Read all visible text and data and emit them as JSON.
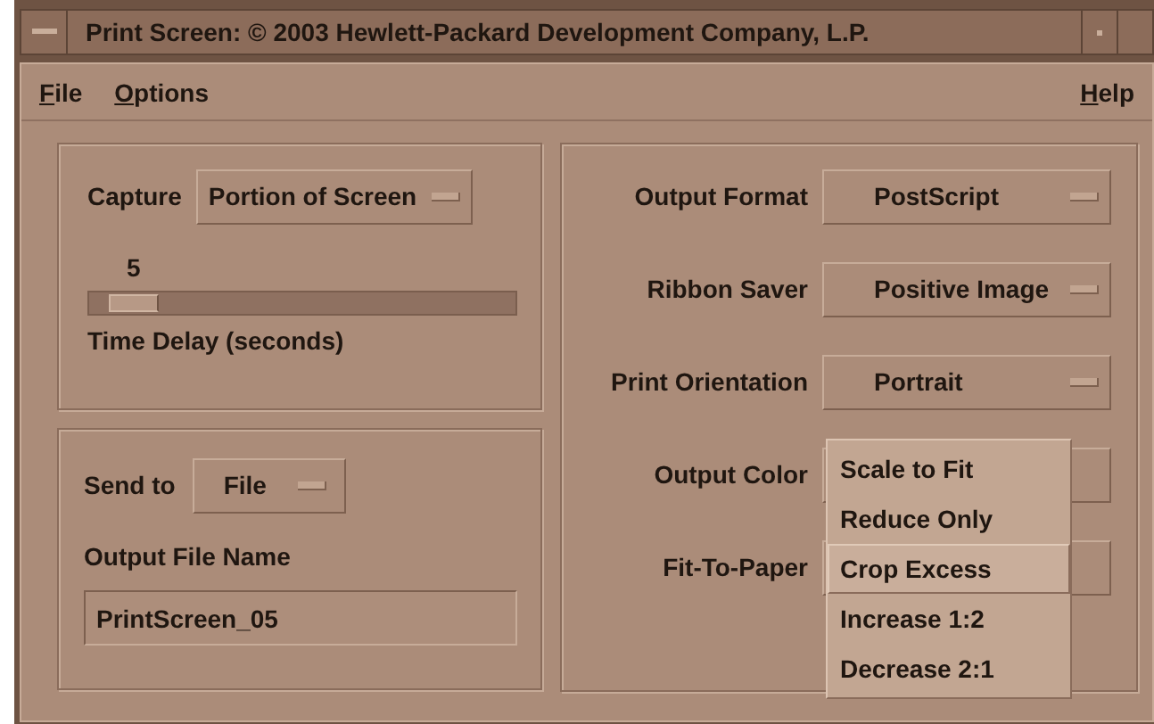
{
  "window": {
    "title": "Print Screen:  © 2003 Hewlett-Packard Development Company, L.P."
  },
  "menu_bar": {
    "left": [
      {
        "label": "File"
      },
      {
        "label": "Options"
      }
    ],
    "right": [
      {
        "label": "Help"
      }
    ]
  },
  "capture": {
    "label": "Capture",
    "value": "Portion of Screen"
  },
  "time_delay": {
    "reading": "5",
    "level": 0.05,
    "label": "Time Delay (seconds)"
  },
  "send_to": {
    "label": "Send to",
    "value": "File"
  },
  "output_file": {
    "label": "Output File Name",
    "value": "PrintScreen_05"
  },
  "options": [
    {
      "label": "Output Format",
      "value": "PostScript"
    },
    {
      "label": "Ribbon Saver",
      "value": "Positive Image"
    },
    {
      "label": "Print Orientation",
      "value": "Portrait"
    },
    {
      "label": "Output Color"
    },
    {
      "label": "Fit-To-Paper"
    }
  ],
  "popup_menu": [
    {
      "label": "Scale to Fit",
      "selected": false
    },
    {
      "label": "Reduce Only",
      "selected": false
    },
    {
      "label": "Crop Excess",
      "selected": true
    },
    {
      "label": "Increase 1:2",
      "selected": false
    },
    {
      "label": "Decrease 2:1",
      "selected": false
    }
  ]
}
